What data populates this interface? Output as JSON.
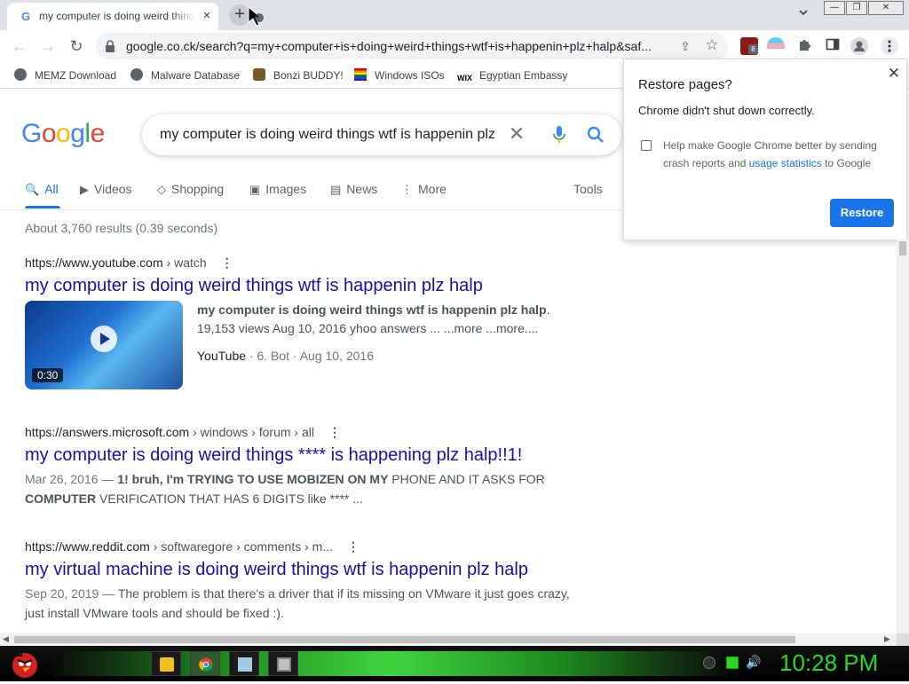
{
  "tab": {
    "favicon": "G",
    "title": "my computer is doing weird things wtf is happenin plz halp",
    "close": "×"
  },
  "new_tab": "+",
  "window_controls": {
    "minimize": "—",
    "restore": "❐",
    "close": "✕"
  },
  "toolbar": {
    "back": "←",
    "forward": "→",
    "reload": "↻",
    "url": "google.co.ck/search?q=my+computer+is+doing+weird+things+wtf+is+happenin+plz+halp&saf...",
    "share": "⇪",
    "star": "☆",
    "extension_badge": "8"
  },
  "bookmarks": [
    {
      "label": "MEMZ Download"
    },
    {
      "label": "Malware Database"
    },
    {
      "label": "Bonzi BUDDY!"
    },
    {
      "label": "Windows ISOs"
    },
    {
      "label": "Egyptian Embassy"
    }
  ],
  "search": {
    "logo": "Google",
    "query": "my computer is doing weird things wtf is happenin plz",
    "clear": "✕"
  },
  "search_tabs": [
    {
      "label": "All",
      "icon": "🔍"
    },
    {
      "label": "Videos",
      "icon": "▶"
    },
    {
      "label": "Shopping",
      "icon": "◇"
    },
    {
      "label": "Images",
      "icon": "▣"
    },
    {
      "label": "News",
      "icon": "▤"
    },
    {
      "label": "More",
      "icon": "⋮"
    }
  ],
  "tools": "Tools",
  "result_stats": "About 3,760 results (0.39 seconds)",
  "results": [
    {
      "site": "https://www.youtube.com",
      "path": " › watch",
      "title": "my computer is doing weird things wtf is happenin plz halp",
      "video": {
        "duration": "0:30",
        "line1_bold": "my computer is doing weird things wtf is happenin plz halp",
        "line1_end": ".",
        "line2": "19,153 views Aug 10, 2016 yhoo answers ... ...more ...more....",
        "source": "YouTube",
        "meta": " · 6. Bot · Aug 10, 2016"
      }
    },
    {
      "site": "https://answers.microsoft.com",
      "path": " › windows › forum › all",
      "title": "my computer is doing weird things **** is happening plz halp!!1!",
      "date": "Mar 26, 2016 — ",
      "snippet_a": "1! bruh, I'm TRYING TO USE MOBIZEN ON ",
      "snippet_b": "MY",
      "snippet_c": " PHONE AND IT ASKS FOR ",
      "snippet_d": "COMPUTER",
      "snippet_e": " VERIFICATION THAT HAS 6 DIGITS like **** ..."
    },
    {
      "site": "https://www.reddit.com",
      "path": " › softwaregore › comments › m...",
      "title": "my virtual machine is doing weird things wtf is happenin plz halp",
      "date": "Sep 20, 2019 — ",
      "snippet": "The problem is that there's a driver that if its missing on VMware it just goes crazy, just install VMware tools and should be fixed :)."
    }
  ],
  "popup": {
    "title": "Restore pages?",
    "message": "Chrome didn't shut down correctly.",
    "checkbox_text_a": "Help make Google Chrome better by sending crash reports and ",
    "checkbox_link": "usage statistics",
    "checkbox_text_b": " to Google",
    "close": "✕",
    "restore_button": "Restore"
  },
  "scrollbar": {
    "left_arrow": "◀",
    "right_arrow": "▶"
  },
  "taskbar": {
    "clock": "10:28 PM"
  },
  "colors": {
    "link": "#1a0dab",
    "accent": "#1a73e8",
    "clock": "#2bd62b"
  }
}
